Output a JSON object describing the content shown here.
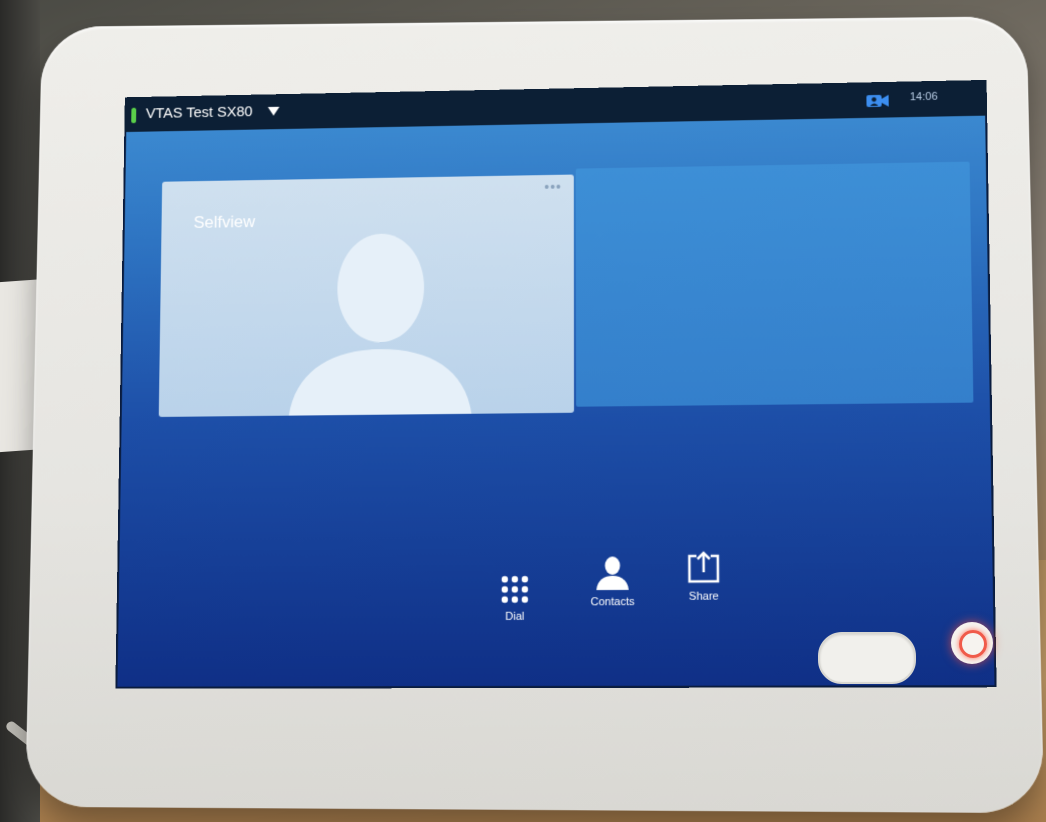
{
  "status_bar": {
    "device_name": "VTAS Test SX80",
    "time": "14:06",
    "camera_icon": "camera-icon"
  },
  "selfview": {
    "label": "Selfview",
    "more_icon": "more-dots-icon",
    "placeholder_icon": "person-silhouette-icon"
  },
  "actions": [
    {
      "label": "Dial",
      "icon": "dial-keypad-icon"
    },
    {
      "label": "Contacts",
      "icon": "contacts-icon"
    },
    {
      "label": "Share",
      "icon": "share-icon"
    }
  ],
  "colors": {
    "status_indicator": "#5ad04a",
    "screen_background": "#1d4fa8",
    "power_led": "#f05a4a"
  }
}
